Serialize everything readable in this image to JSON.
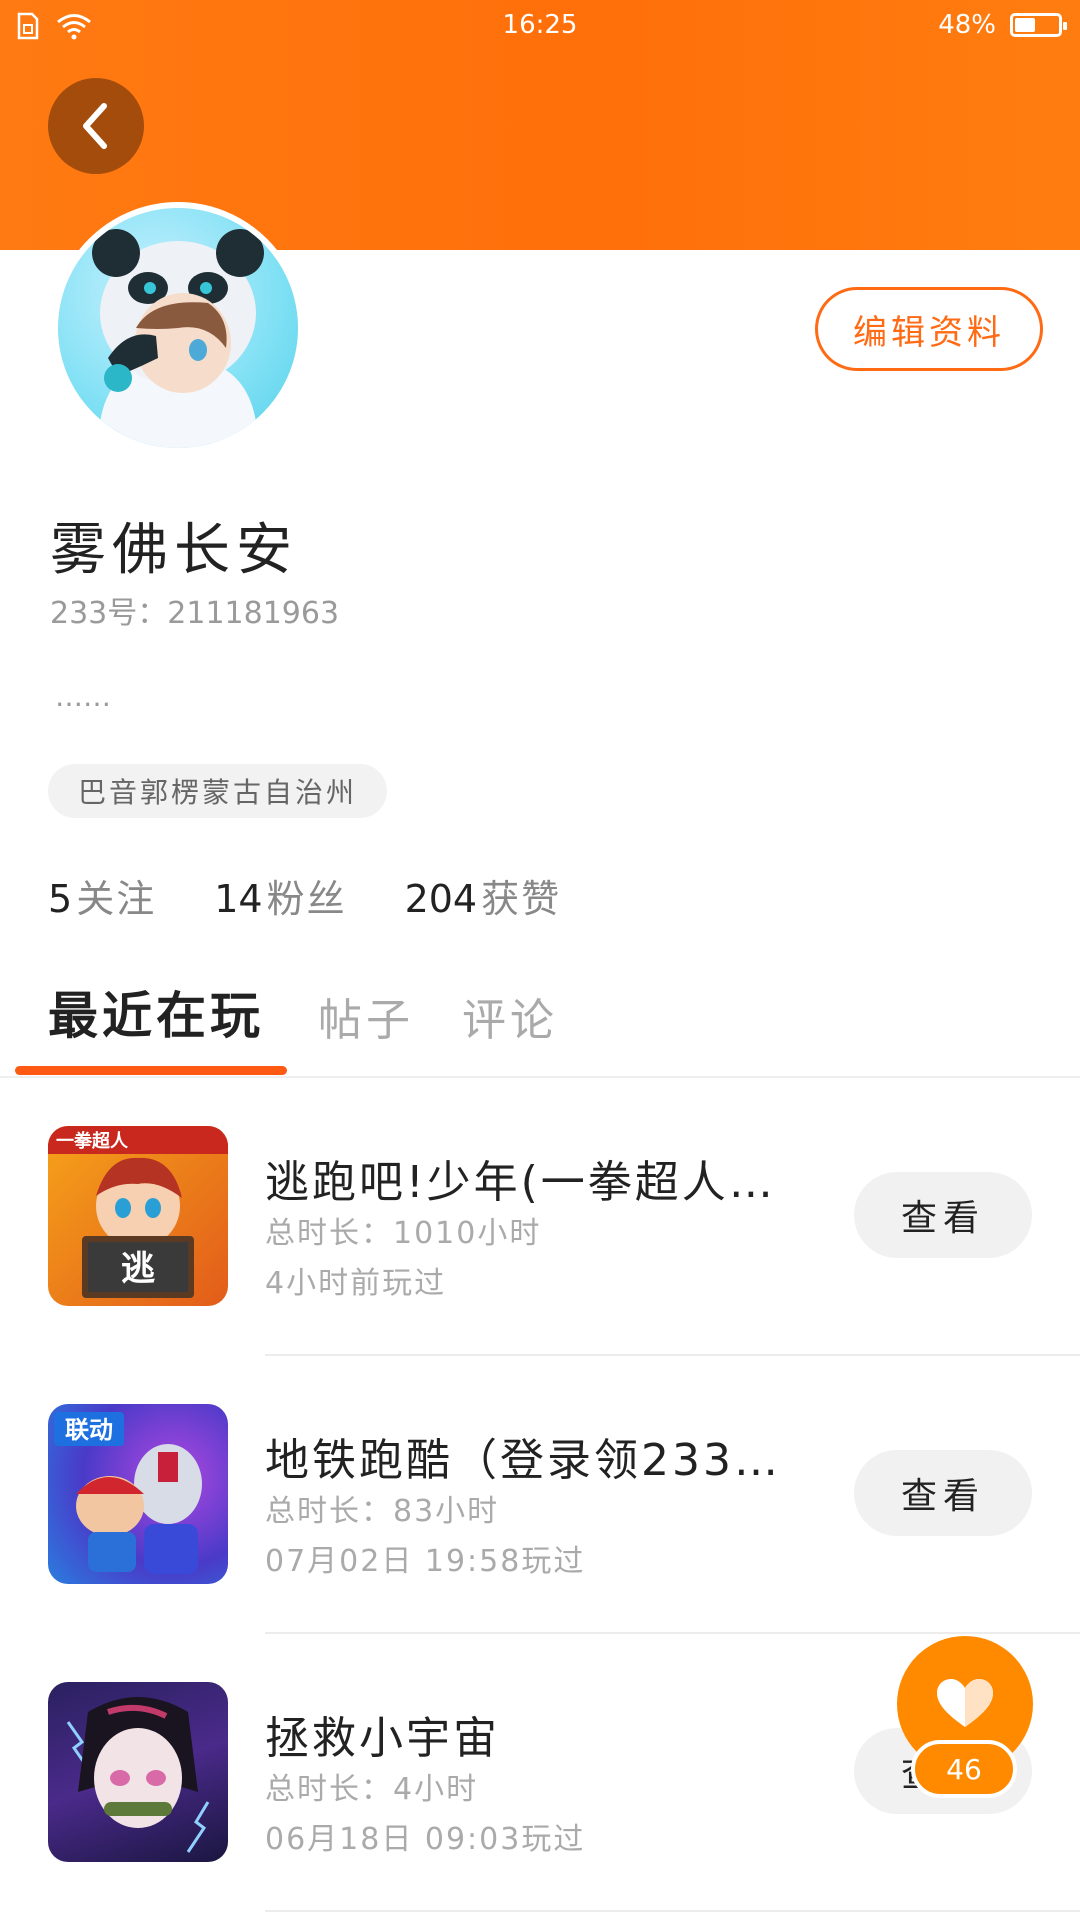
{
  "status_bar": {
    "time": "16:25",
    "battery": "48%"
  },
  "profile": {
    "edit_label": "编辑资料",
    "name": "雾佛长安",
    "id_label": "233号：",
    "id_value": "211181963",
    "bio": "……",
    "location": "巴音郭楞蒙古自治州"
  },
  "stats": [
    {
      "count": "5",
      "label": "关注"
    },
    {
      "count": "14",
      "label": "粉丝"
    },
    {
      "count": "204",
      "label": "获赞"
    }
  ],
  "tabs": [
    {
      "label": "最近在玩"
    },
    {
      "label": "帖子"
    },
    {
      "label": "评论"
    }
  ],
  "games": [
    {
      "title": "逃跑吧!少年(一拳超人联动)",
      "playtime": "总时长：1010小时",
      "last_played": "4小时前玩过",
      "button": "查看",
      "icon_text": "逃",
      "icon_banner": "一拳超人"
    },
    {
      "title": "地铁跑酷（登录领233联…",
      "playtime": "总时长：83小时",
      "last_played": "07月02日 19:58玩过",
      "button": "查看",
      "icon_text": "联动"
    },
    {
      "title": "拯救小宇宙",
      "playtime": "总时长：4小时",
      "last_played": "06月18日 09:03玩过",
      "button": "查看"
    }
  ],
  "like": {
    "count": "46"
  },
  "colors": {
    "accent": "#ff6a14",
    "header": "#ff7510",
    "fab": "#ff8a00"
  }
}
